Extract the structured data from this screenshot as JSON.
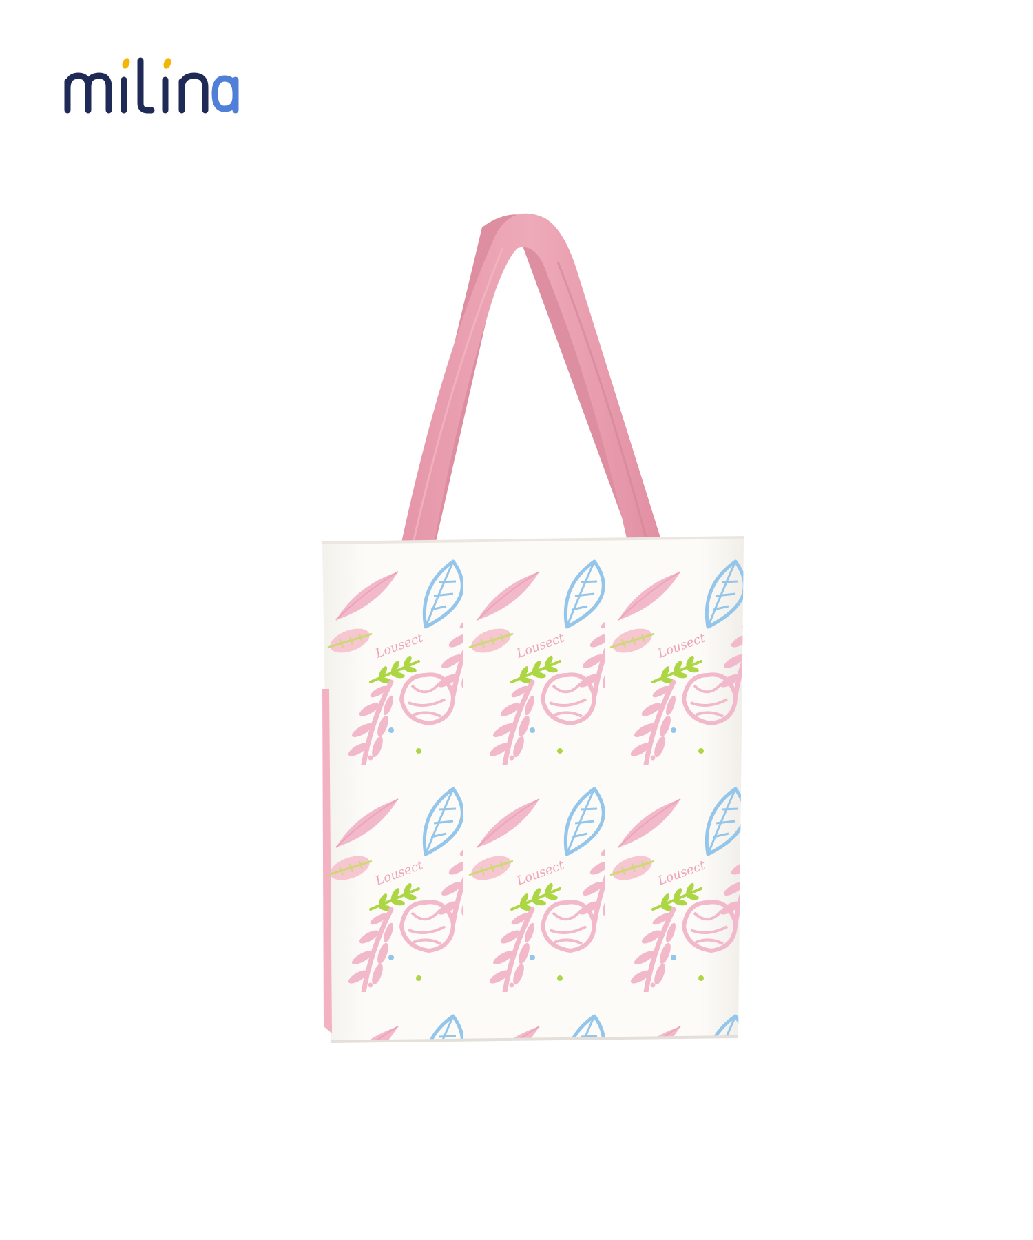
{
  "brand": {
    "name": "milina",
    "logo_colors": {
      "text": "#1f2a56",
      "dots": "#f2b705",
      "accent_a": "#4f7fd6"
    }
  },
  "product": {
    "item": "tote-bag",
    "colors": {
      "handle": "#e9a2b1",
      "handle_shadow": "#d9899b",
      "body": "#fbfaf6",
      "leaf_pink": "#f1b6c9",
      "leaf_blue": "#8fc3ea",
      "leaf_green": "#a9d43c",
      "print_text": "#ee9fb8"
    },
    "print_word": "Lousect"
  }
}
